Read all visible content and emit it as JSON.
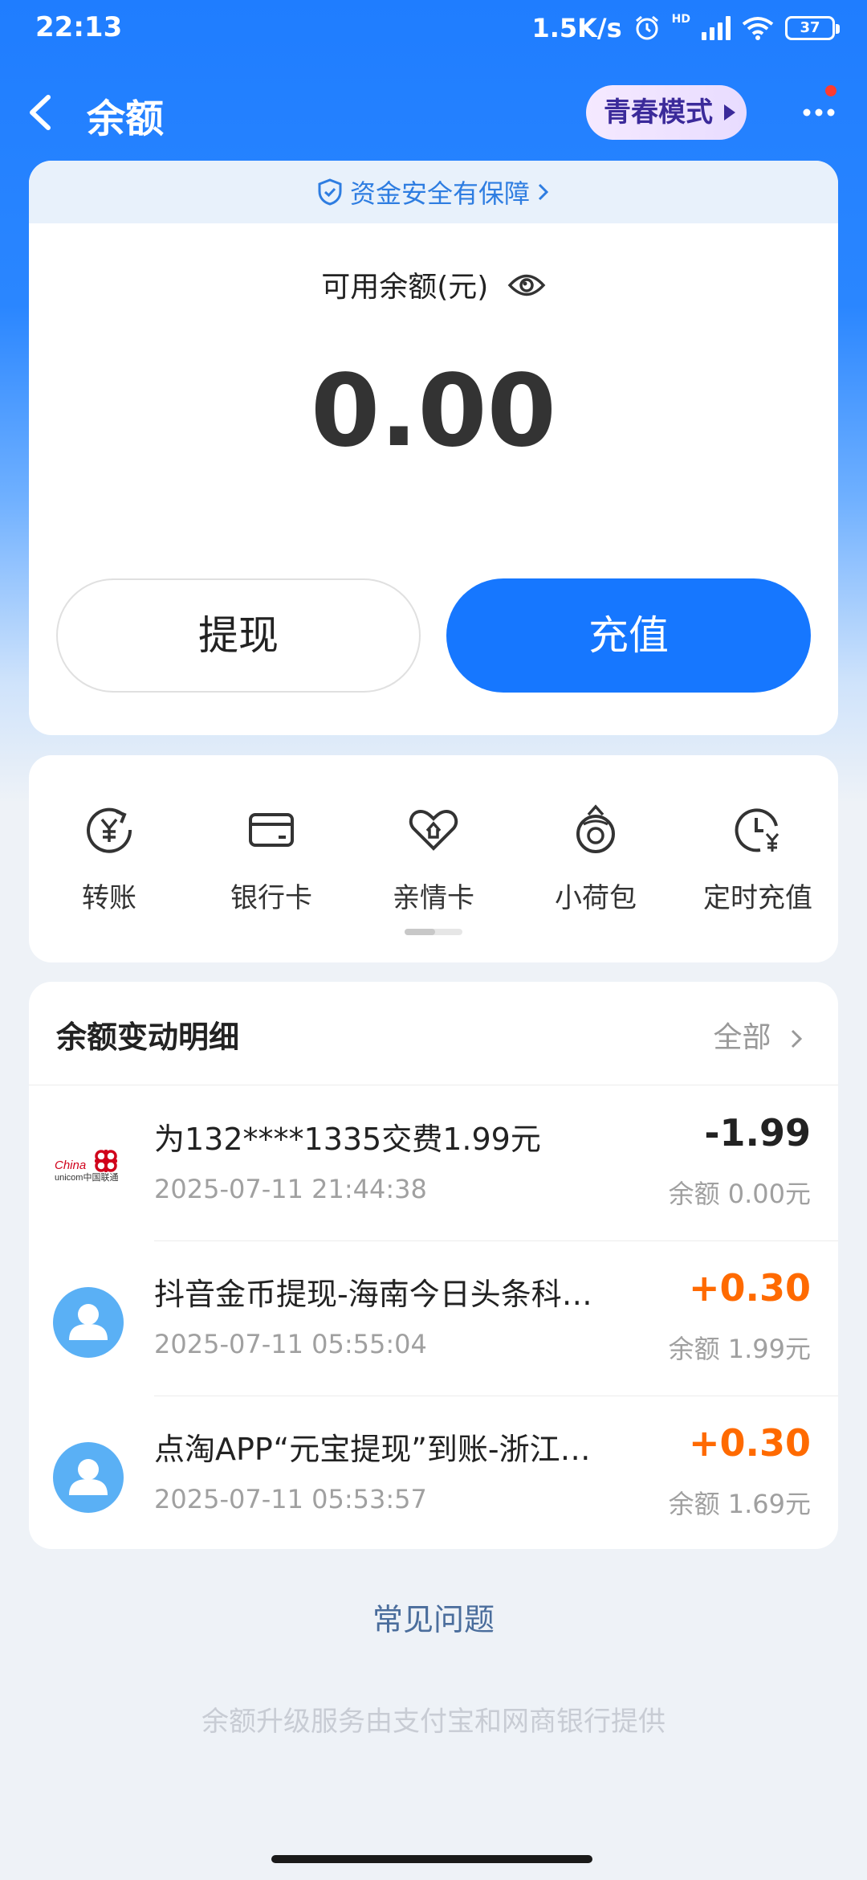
{
  "status_bar": {
    "time": "22:13",
    "net_speed": "1.5K/s",
    "hd": "HD",
    "battery": "37"
  },
  "header": {
    "title": "余额",
    "youth_mode": "青春模式"
  },
  "balance_card": {
    "security_text": "资金安全有保障",
    "available_label": "可用余额(元)",
    "amount": "0.00",
    "withdraw_label": "提现",
    "topup_label": "充值"
  },
  "shortcuts": [
    {
      "label": "转账",
      "icon": "transfer-yuan-icon"
    },
    {
      "label": "银行卡",
      "icon": "bank-card-icon"
    },
    {
      "label": "亲情卡",
      "icon": "family-card-heart-icon"
    },
    {
      "label": "小荷包",
      "icon": "small-purse-icon"
    },
    {
      "label": "定时充值",
      "icon": "scheduled-topup-clock-icon"
    }
  ],
  "details": {
    "title": "余额变动明细",
    "filter_label": "全部"
  },
  "transactions": [
    {
      "name": "为132****1335交费1.99元",
      "date": "2025-07-11 21:44:38",
      "amount": "-1.99",
      "balance": "余额 0.00元",
      "logo": "china-unicom-logo"
    },
    {
      "name": "抖音金币提现-海南今日头条科技有…",
      "date": "2025-07-11 05:55:04",
      "amount": "+0.30",
      "balance": "余额 1.99元",
      "logo": "user-avatar-icon"
    },
    {
      "name": "点淘APP“元宝提现”到账-浙江阿里巴…",
      "date": "2025-07-11 05:53:57",
      "amount": "+0.30",
      "balance": "余额 1.69元",
      "logo": "user-avatar-icon"
    }
  ],
  "colors": {
    "brand_blue": "#1677ff",
    "income_orange": "#ff6a00",
    "expense_dark": "#222222"
  },
  "faq_label": "常见问题",
  "footer_text": "余额升级服务由支付宝和网商银行提供"
}
